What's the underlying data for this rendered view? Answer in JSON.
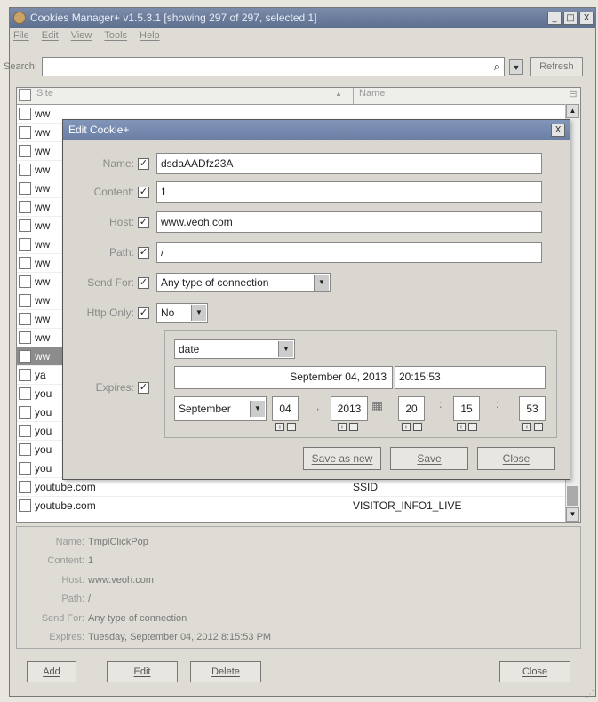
{
  "window": {
    "title": "Cookies Manager+ v1.5.3.1 [showing 297 of 297, selected 1]",
    "min": "_",
    "max": "□",
    "close": "X"
  },
  "menu": [
    "File",
    "Edit",
    "View",
    "Tools",
    "Help"
  ],
  "search": {
    "label": "Search:",
    "value": "",
    "refresh": "Refresh"
  },
  "columns": {
    "site": "Site",
    "name": "Name"
  },
  "rows": [
    {
      "site": "ww",
      "name": "",
      "checked": false
    },
    {
      "site": "ww",
      "name": "",
      "checked": false
    },
    {
      "site": "ww",
      "name": "",
      "checked": false
    },
    {
      "site": "ww",
      "name": "",
      "checked": false
    },
    {
      "site": "ww",
      "name": "",
      "checked": false
    },
    {
      "site": "ww",
      "name": "",
      "checked": false
    },
    {
      "site": "ww",
      "name": "",
      "checked": false
    },
    {
      "site": "ww",
      "name": "",
      "checked": false
    },
    {
      "site": "ww",
      "name": "",
      "checked": false
    },
    {
      "site": "ww",
      "name": "",
      "checked": false
    },
    {
      "site": "ww",
      "name": "",
      "checked": false
    },
    {
      "site": "ww",
      "name": "",
      "checked": false
    },
    {
      "site": "ww",
      "name": "",
      "checked": false
    },
    {
      "site": "ww",
      "name": "",
      "checked": true
    },
    {
      "site": "ya",
      "name": "",
      "checked": false
    },
    {
      "site": "you",
      "name": "",
      "checked": false
    },
    {
      "site": "you",
      "name": "",
      "checked": false
    },
    {
      "site": "you",
      "name": "",
      "checked": false
    },
    {
      "site": "you",
      "name": "",
      "checked": false
    },
    {
      "site": "you",
      "name": "",
      "checked": false
    },
    {
      "site": "youtube.com",
      "name": "SSID",
      "checked": false
    },
    {
      "site": "youtube.com",
      "name": "VISITOR_INFO1_LIVE",
      "checked": false
    }
  ],
  "details": [
    {
      "key": "Name:",
      "value": "TmplClickPop"
    },
    {
      "key": "Content:",
      "value": "1"
    },
    {
      "key": "Host:",
      "value": "www.veoh.com"
    },
    {
      "key": "Path:",
      "value": "/"
    },
    {
      "key": "Send For:",
      "value": "Any type of connection"
    },
    {
      "key": "Expires:",
      "value": "Tuesday, September 04, 2012 8:15:53 PM"
    }
  ],
  "buttons": {
    "add": "Add",
    "edit": "Edit",
    "delete": "Delete",
    "close": "Close"
  },
  "dialog": {
    "title": "Edit Cookie+",
    "close": "X",
    "name_label": "Name:",
    "name_value": "dsdaAADfz23A",
    "content_label": "Content:",
    "content_value": "1",
    "host_label": "Host:",
    "host_value": "www.veoh.com",
    "path_label": "Path:",
    "path_value": "/",
    "sendfor_label": "Send For:",
    "sendfor_value": "Any type of connection",
    "httponly_label": "Http Only:",
    "httponly_value": "No",
    "expires_label": "Expires:",
    "expires_type": "date",
    "expires_date": "September 04, 2013",
    "expires_time": "20:15:53",
    "month": "September",
    "day": "04",
    "year": "2013",
    "hour": "20",
    "minute": "15",
    "second": "53",
    "save_as_new": "Save as new",
    "save": "Save",
    "close_btn": "Close"
  },
  "colors": {
    "title_bar": "#6a7fa3",
    "selected_row": "#8c8c8c"
  }
}
